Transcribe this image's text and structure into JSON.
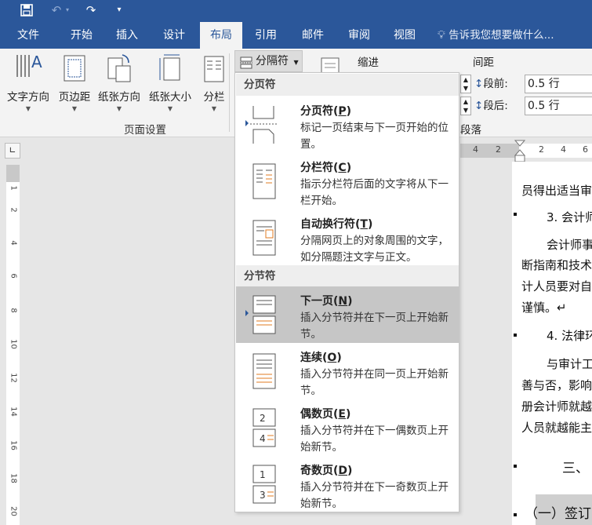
{
  "tabs": [
    "文件",
    "开始",
    "插入",
    "设计",
    "布局",
    "引用",
    "邮件",
    "审阅",
    "视图"
  ],
  "active_tab": "布局",
  "tell_me": "告诉我您想要做什么...",
  "ribbon": {
    "text_direction": "文字方向",
    "margins": "页边距",
    "orientation": "纸张方向",
    "size": "纸张大小",
    "columns": "分栏",
    "breaks": "分隔符",
    "group_label": "页面设置",
    "indent": "缩进",
    "spacing": "间距",
    "before_label": "段前:",
    "before_value": "0.5 行",
    "after_label": "段后:",
    "after_value": "0.5 行",
    "para_group": "段落"
  },
  "menu": {
    "section1": "分页符",
    "section2": "分节符",
    "items": [
      {
        "title": "分页符(",
        "key": "P",
        "desc": "标记一页结束与下一页开始的位置。"
      },
      {
        "title": "分栏符(",
        "key": "C",
        "desc": "指示分栏符后面的文字将从下一栏开始。"
      },
      {
        "title": "自动换行符(",
        "key": "T",
        "desc": "分隔网页上的对象周围的文字，如分隔题注文字与正文。"
      },
      {
        "title": "下一页(",
        "key": "N",
        "desc": "插入分节符并在下一页上开始新节。"
      },
      {
        "title": "连续(",
        "key": "O",
        "desc": "插入分节符并在同一页上开始新节。"
      },
      {
        "title": "偶数页(",
        "key": "E",
        "desc": "插入分节符并在下一偶数页上开始新节。"
      },
      {
        "title": "奇数页(",
        "key": "D",
        "desc": "插入分节符并在下一奇数页上开始新节。"
      }
    ]
  },
  "ruler": {
    "h": [
      "4",
      "2",
      "2",
      "4",
      "6"
    ],
    "v": [
      "1",
      "2",
      "4",
      "6",
      "8",
      "10",
      "12",
      "14",
      "16",
      "18",
      "20"
    ]
  },
  "doc": {
    "lines": [
      "员得出适当审",
      "3. 会计师",
      "会计师事",
      "断指南和技术",
      "计人员要对自",
      "谨慎。↵",
      "4. 法律环",
      "与审计工",
      "善与否，影响",
      "册会计师就越",
      "人员就越能主",
      "三、",
      "（一）签订"
    ]
  }
}
